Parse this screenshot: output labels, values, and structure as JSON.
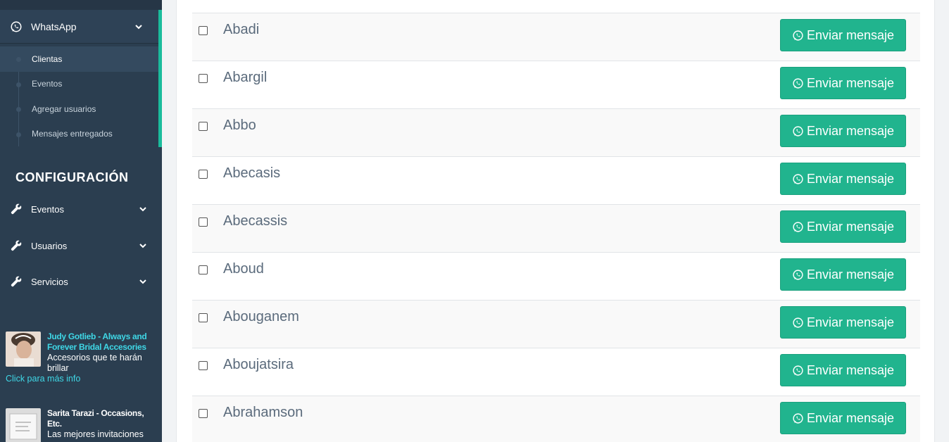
{
  "sidebar": {
    "whatsapp_label": "WhatsApp",
    "submenu": [
      "Clientas",
      "Eventos",
      "Agregar usuarios",
      "Mensajes entregados"
    ],
    "config_title": "CONFIGURACIÓN",
    "config_items": [
      "Eventos",
      "Usuarios",
      "Servicios"
    ],
    "ads": [
      {
        "title": "Judy Gotlieb - Always and Forever Bridal Accesories",
        "description": "Accesorios que te harán brillar",
        "more": "Click para más info"
      },
      {
        "title": "Sarita Tarazi - Occasions, Etc.",
        "description": "Las mejores invitaciones"
      }
    ]
  },
  "contacts": {
    "button_label": "Enviar mensaje",
    "names": [
      "Abadi",
      "Abargil",
      "Abbo",
      "Abecasis",
      "Abecassis",
      "Aboud",
      "Abouganem",
      "Aboujatsira",
      "Abrahamson"
    ]
  },
  "colors": {
    "sidebar_bg": "#2b3e50",
    "accent": "#1abc9c",
    "button": "#21b48e",
    "ad_title": "#3fd7e6"
  }
}
